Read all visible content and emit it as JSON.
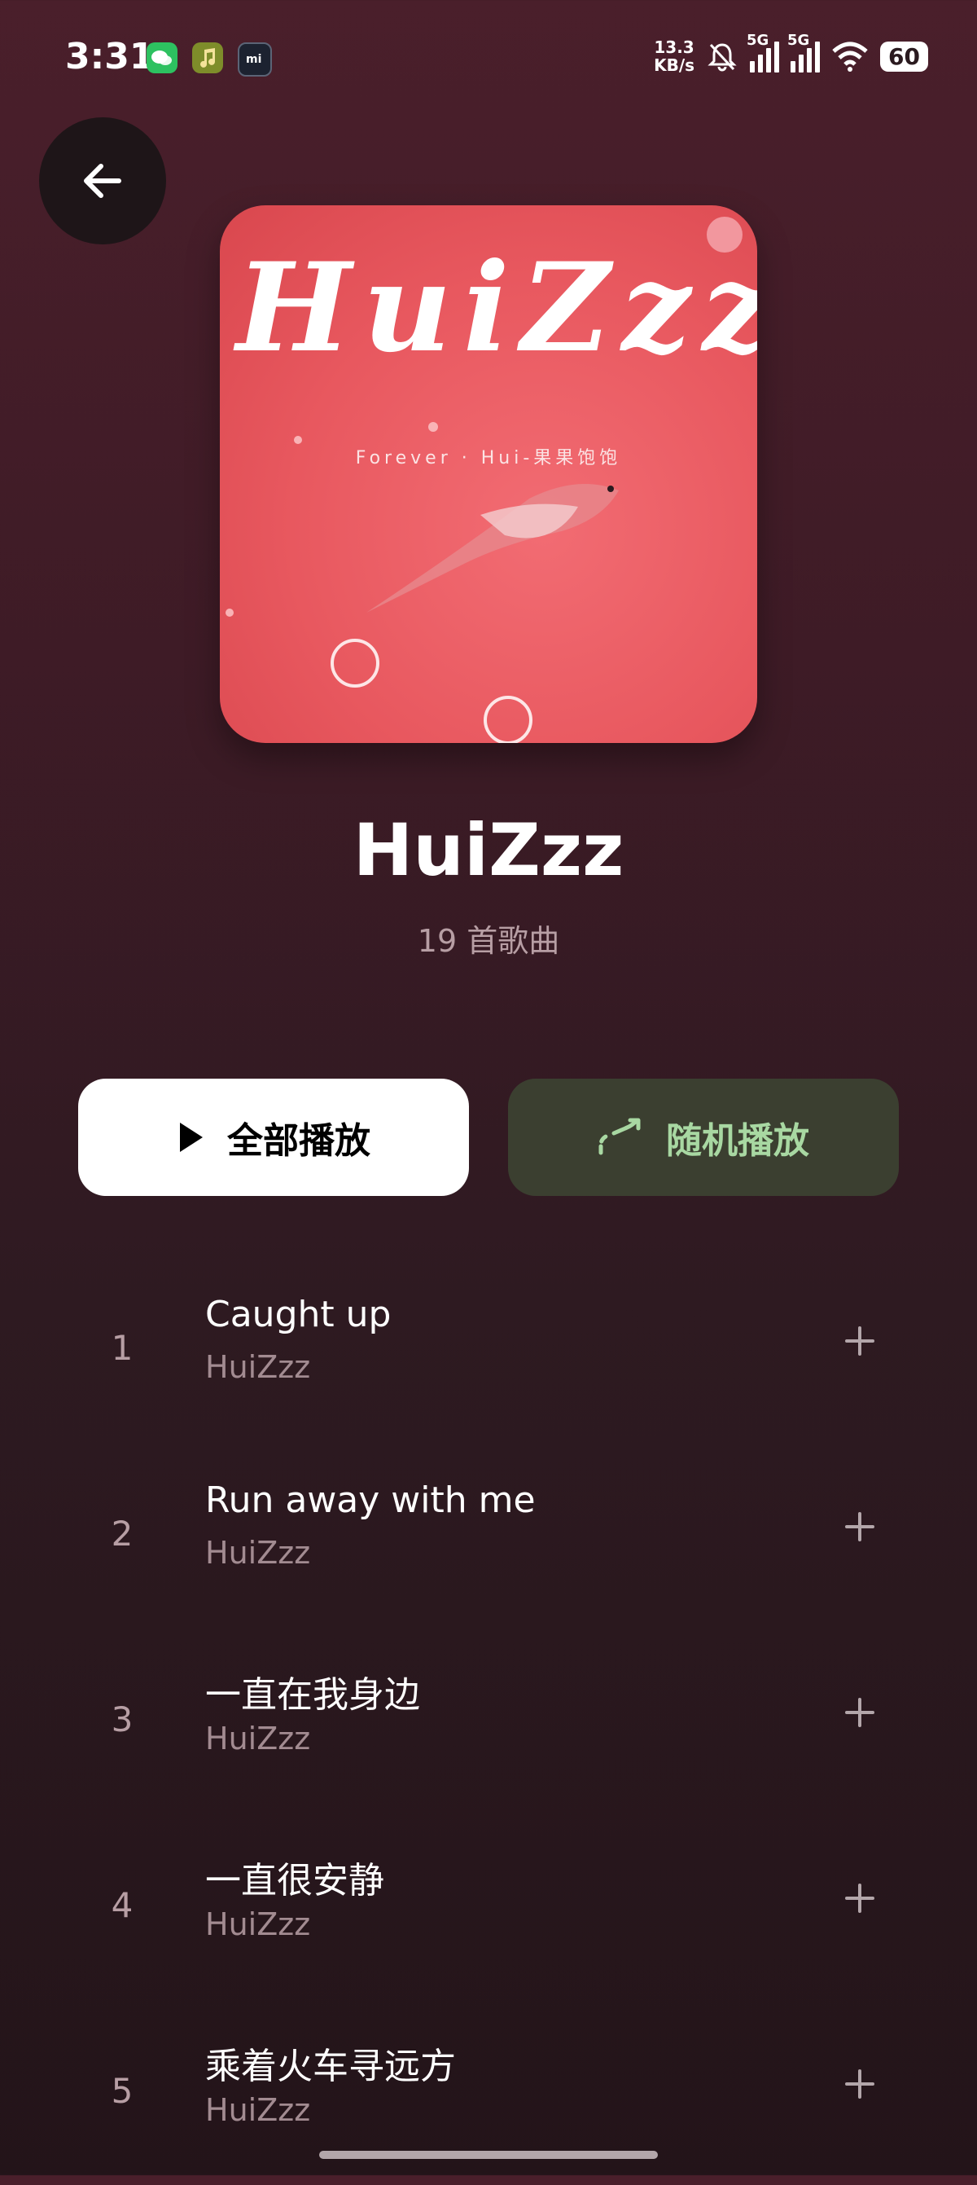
{
  "status_bar": {
    "time": "3:31",
    "net_speed_value": "13.3",
    "net_speed_unit": "KB/s",
    "sim1_label": "5G",
    "sim2_label": "5G",
    "battery": "60",
    "icons": [
      "wechat-icon",
      "music-app-icon",
      "mi-icon",
      "mute-bell-icon",
      "signal-icon",
      "wifi-icon",
      "battery-icon"
    ]
  },
  "album": {
    "cover_title": "HuiZzz",
    "cover_subtitle": "Forever · Hui-果果饱饱",
    "title": "HuiZzz",
    "song_count": "19 首歌曲"
  },
  "actions": {
    "play_all": "全部播放",
    "shuffle": "随机播放"
  },
  "songs": [
    {
      "num": "1",
      "title": "Caught up",
      "artist": "HuiZzz"
    },
    {
      "num": "2",
      "title": "Run away with me",
      "artist": "HuiZzz"
    },
    {
      "num": "3",
      "title": "一直在我身边",
      "artist": "HuiZzz"
    },
    {
      "num": "4",
      "title": "一直很安静",
      "artist": "HuiZzz"
    },
    {
      "num": "5",
      "title": "乘着火车寻远方",
      "artist": "HuiZzz"
    }
  ],
  "colors": {
    "background_top": "#4a1f2b",
    "background_bottom": "#231419",
    "shuffle_bg": "#3b3f30",
    "shuffle_fg": "#a8d8a2",
    "cover_red": "#ec5f66"
  }
}
